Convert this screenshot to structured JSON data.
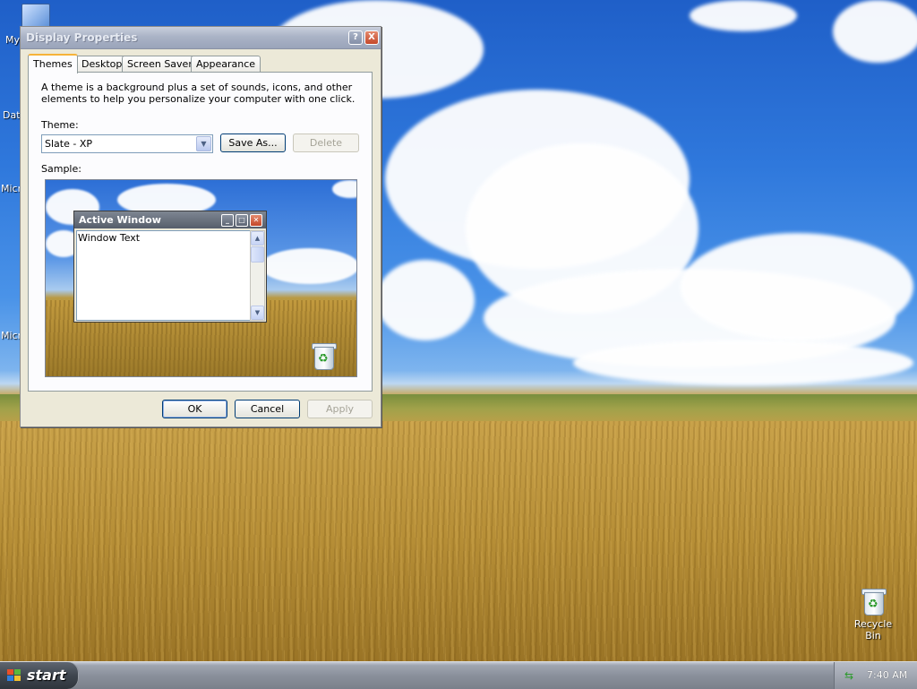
{
  "desktop": {
    "icons_partial": [
      "My",
      "Dat",
      "Micro",
      "Micro"
    ],
    "recycle_bin_label": "Recycle Bin"
  },
  "dialog": {
    "title": "Display Properties",
    "title_buttons": [
      "?",
      "X"
    ],
    "tabs": [
      {
        "label": "Themes",
        "active": true
      },
      {
        "label": "Desktop",
        "active": false
      },
      {
        "label": "Screen Saver",
        "active": false
      },
      {
        "label": "Appearance",
        "active": false
      }
    ],
    "description": "A theme is a background plus a set of sounds, icons, and other elements to help you personalize your computer with one click.",
    "theme_label": "Theme:",
    "theme_value": "Slate - XP",
    "save_as_label": "Save As...",
    "delete_label": "Delete",
    "sample_label": "Sample:",
    "sample": {
      "window_title": "Active Window",
      "window_text": "Window Text"
    },
    "ok_label": "OK",
    "cancel_label": "Cancel",
    "apply_label": "Apply"
  },
  "taskbar": {
    "start_label": "start",
    "clock": "7:40 AM"
  },
  "colors": {
    "window_face": "#ece9d8",
    "tab_highlight": "#f6b33a",
    "titlebar_inactive": "#aab3c6",
    "close_red": "#c4482a"
  }
}
